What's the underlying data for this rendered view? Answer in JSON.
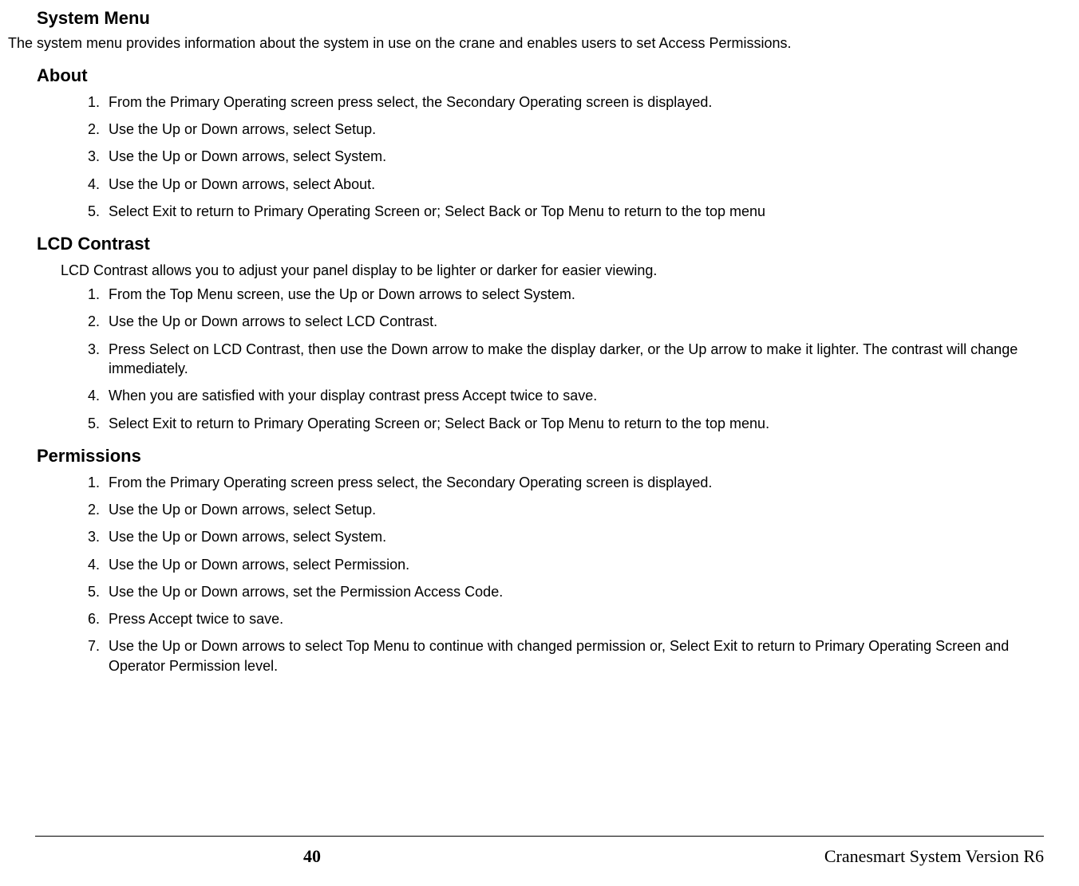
{
  "title": "System Menu",
  "intro": "The system menu provides information about the system in use on the crane and enables users to set Access Permissions.",
  "sections": [
    {
      "heading": "About",
      "sub": "",
      "steps": [
        "From the Primary Operating screen press select, the Secondary Operating screen is displayed.",
        "Use the Up or Down arrows, select Setup.",
        "Use the Up or Down arrows, select System.",
        "Use the Up or Down arrows, select About.",
        "Select Exit to return to Primary Operating Screen or; Select Back or Top Menu to return to the top menu"
      ]
    },
    {
      "heading": "LCD Contrast",
      "sub": "LCD Contrast allows you to adjust your panel display to be lighter or darker for easier viewing.",
      "steps": [
        "From the Top Menu screen, use the Up or Down arrows to select System.",
        "Use the Up or Down arrows to select LCD Contrast.",
        "Press Select on LCD Contrast, then use the Down arrow to make the display darker, or the Up arrow to make it lighter.  The contrast will change immediately.",
        "When you are satisfied with your display contrast press Accept twice to save.",
        "Select Exit to return to Primary Operating Screen or; Select Back or Top Menu to return to the top menu."
      ]
    },
    {
      "heading": "Permissions",
      "sub": "",
      "steps": [
        "From the Primary Operating screen press select, the Secondary Operating screen is displayed.",
        "Use the Up or Down arrows, select Setup.",
        "Use the Up or Down arrows, select System.",
        "Use the Up or Down arrows, select Permission.",
        "Use the Up or Down arrows, set the Permission Access Code.",
        "Press Accept twice to save.",
        "Use the Up or Down arrows to select Top Menu to continue with changed permission or, Select Exit to return to Primary Operating Screen and Operator Permission level."
      ]
    }
  ],
  "footer": {
    "page": "40",
    "doc": "Cranesmart System Version R6"
  }
}
